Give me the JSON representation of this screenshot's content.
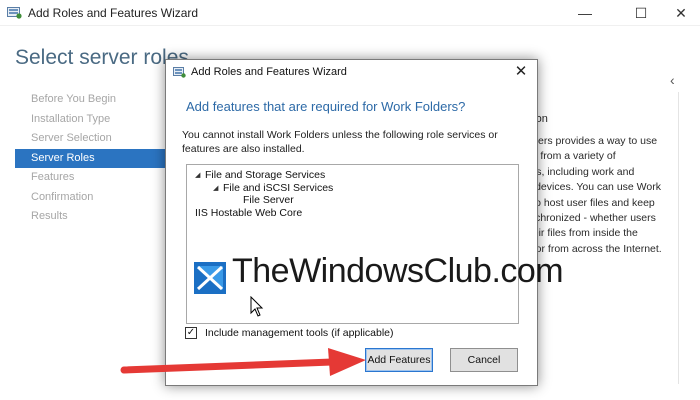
{
  "outer_window": {
    "title": "Add Roles and Features Wizard",
    "minimize_glyph": "—",
    "maximize_glyph": "☐",
    "close_glyph": "✕"
  },
  "page": {
    "title": "Select server roles"
  },
  "nav": {
    "items": [
      {
        "label": "Before You Begin",
        "active": false
      },
      {
        "label": "Installation Type",
        "active": false
      },
      {
        "label": "Server Selection",
        "active": false
      },
      {
        "label": "Server Roles",
        "active": true
      },
      {
        "label": "Features",
        "active": false
      },
      {
        "label": "Confirmation",
        "active": false
      },
      {
        "label": "Results",
        "active": false
      }
    ]
  },
  "description": {
    "heading": "ption",
    "lines": [
      "olders provides a way to use",
      "les from a variety of",
      "ters, including work and",
      "al devices. You can use Work",
      "s to host user files and keep",
      "ynchronized - whether users",
      "their files from inside the",
      "rk or from across the Internet."
    ]
  },
  "dialog": {
    "title": "Add Roles and Features Wizard",
    "close_glyph": "✕",
    "heading": "Add features that are required for Work Folders?",
    "message": "You cannot install Work Folders unless the following role services or features are also installed.",
    "tree": [
      {
        "label": "File and Storage Services",
        "level": 0,
        "expanded": true
      },
      {
        "label": "File and iSCSI Services",
        "level": 1,
        "expanded": true
      },
      {
        "label": "File Server",
        "level": 2,
        "expanded": false
      },
      {
        "label": "IIS Hostable Web Core",
        "level": 0,
        "expanded": false
      }
    ],
    "tree_arrow": "◢",
    "include_tools_label": "Include management tools (if applicable)",
    "include_tools_checked": true,
    "check_glyph": "✓",
    "add_button": "Add Features",
    "cancel_button": "Cancel"
  },
  "watermark": {
    "text": "TheWindowsClub.com"
  },
  "colors": {
    "accent": "#2b74c1",
    "heading_blue": "#2d6aa7",
    "arrow_red": "#e53935"
  }
}
